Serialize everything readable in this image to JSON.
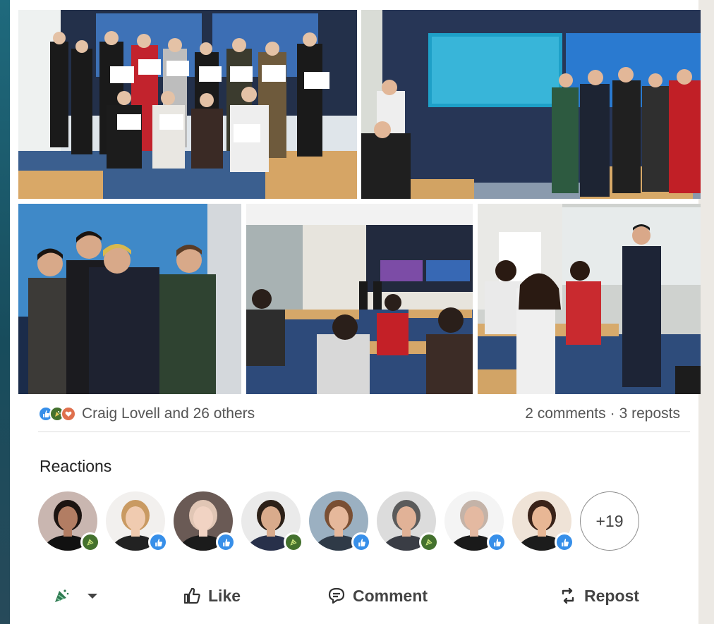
{
  "post": {
    "reactions_summary": {
      "text": "Craig Lovell and 26 others",
      "icons": [
        "like-icon",
        "celebrate-icon",
        "love-icon"
      ]
    },
    "comments_text": "2 comments",
    "separator": "·",
    "reposts_text": "3 reposts",
    "reactions_section": {
      "title": "Reactions",
      "more_count": "+19",
      "avatars": [
        {
          "reaction": "celebrate",
          "bg": "#c9b6b0",
          "skin": "#b27d63",
          "hair": "#1c1411",
          "shirt": "#111111"
        },
        {
          "reaction": "like",
          "bg": "#f2f0ee",
          "skin": "#f0cbb0",
          "hair": "#c99a62",
          "shirt": "#222222"
        },
        {
          "reaction": "like",
          "bg": "#6a5a55",
          "skin": "#f1d3c3",
          "hair": "#e1c6b5",
          "shirt": "#1b1b1b"
        },
        {
          "reaction": "celebrate",
          "bg": "#eaeaea",
          "skin": "#d9ab8c",
          "hair": "#2d2118",
          "shirt": "#28304a"
        },
        {
          "reaction": "like",
          "bg": "#9bb0c1",
          "skin": "#e6b89b",
          "hair": "#7a4f33",
          "shirt": "#2f3a47"
        },
        {
          "reaction": "celebrate",
          "bg": "#dcdcdc",
          "skin": "#e1b297",
          "hair": "#5b5b5b",
          "shirt": "#3a3d45"
        },
        {
          "reaction": "like",
          "bg": "#f4f4f4",
          "skin": "#e4b9a1",
          "hair": "#c4b3a8",
          "shirt": "#1a1a1a"
        },
        {
          "reaction": "like",
          "bg": "#efe3d7",
          "skin": "#e8b795",
          "hair": "#3a2319",
          "shirt": "#1c1c1c"
        }
      ]
    },
    "actions": {
      "like": "Like",
      "comment": "Comment",
      "repost": "Repost"
    }
  },
  "colors": {
    "like_blue": "#378fe9",
    "celebrate_green": "#44712e",
    "love_red": "#df704d"
  }
}
